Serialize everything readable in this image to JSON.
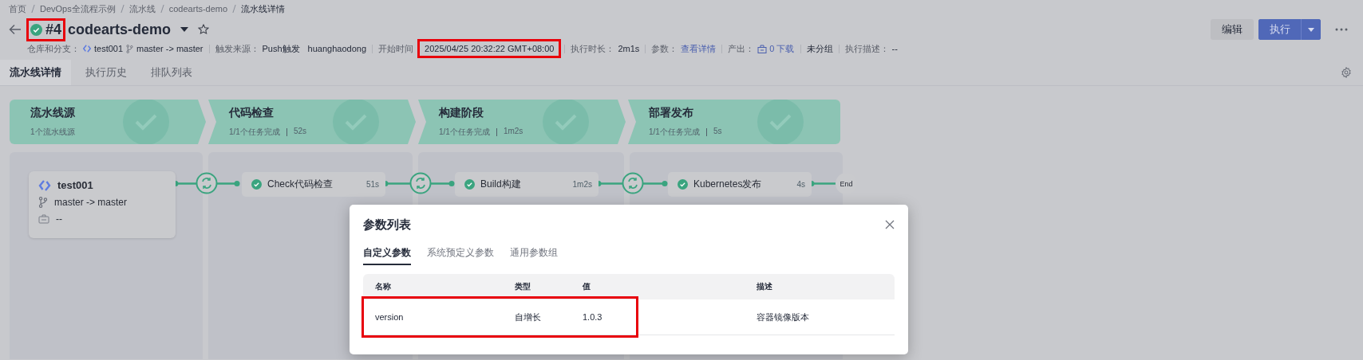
{
  "breadcrumb": [
    "首页",
    "DevOps全流程示例",
    "流水线",
    "codearts-demo",
    "流水线详情"
  ],
  "header": {
    "run": {
      "number": "#4",
      "passed": true,
      "highlighted": true
    },
    "title": "codearts-demo",
    "starred": false,
    "buttons": [
      {
        "kind": "default",
        "label": "编辑"
      },
      {
        "kind": "primary",
        "label": "执行"
      }
    ]
  },
  "meta": [
    {
      "kind": "repo",
      "label": "仓库和分支：",
      "repo": "test001",
      "branch": "master -> master"
    },
    {
      "kind": "pair",
      "label": "触发来源：",
      "values": [
        "Push触发",
        "huanghaodong"
      ]
    },
    {
      "kind": "pair",
      "label": "开始时间",
      "values": [
        "2025/04/25 20:32:22 GMT+08:00"
      ],
      "highlighted": true
    },
    {
      "kind": "pair",
      "label": "执行时长：",
      "values": [
        "2m1s"
      ]
    },
    {
      "kind": "link",
      "label": "参数：",
      "value": "查看详情"
    },
    {
      "kind": "download",
      "label": "产出：",
      "value": "0 下载"
    },
    {
      "kind": "plain",
      "value": "未分组"
    },
    {
      "kind": "pair",
      "label": "执行描述：",
      "values": [
        "--"
      ]
    }
  ],
  "tabs": [
    {
      "label": "流水线详情",
      "selected": true
    },
    {
      "label": "执行历史",
      "selected": false
    },
    {
      "label": "排队列表",
      "selected": false
    }
  ],
  "stages": [
    {
      "title": "流水线源",
      "summary": "1个流水线源",
      "passed": true
    },
    {
      "title": "代码检查",
      "summary": "1/1个任务完成",
      "duration": "52s",
      "passed": true
    },
    {
      "title": "构建阶段",
      "summary": "1/1个任务完成",
      "duration": "1m2s",
      "passed": true
    },
    {
      "title": "部署发布",
      "summary": "1/1个任务完成",
      "duration": "5s",
      "passed": true
    }
  ],
  "pipeline": {
    "source": {
      "repo": "test001",
      "branch": "master -> master",
      "tag": "--"
    },
    "jobs": [
      {
        "name": "Check代码检查",
        "duration": "51s",
        "passed": true
      },
      {
        "name": "Build构建",
        "duration": "1m2s",
        "passed": true
      },
      {
        "name": "Kubernetes发布",
        "duration": "4s",
        "passed": true
      }
    ],
    "end": "End"
  },
  "modal": {
    "title": "参数列表",
    "tabs": [
      {
        "label": "自定义参数",
        "selected": true
      },
      {
        "label": "系统预定义参数",
        "selected": false
      },
      {
        "label": "通用参数组",
        "selected": false
      }
    ],
    "columns": [
      "名称",
      "类型",
      "值",
      "描述"
    ],
    "rows": [
      {
        "cells": [
          "version",
          "自增长",
          "1.0.3",
          "容器镜像版本"
        ],
        "highlighted": true
      }
    ]
  }
}
